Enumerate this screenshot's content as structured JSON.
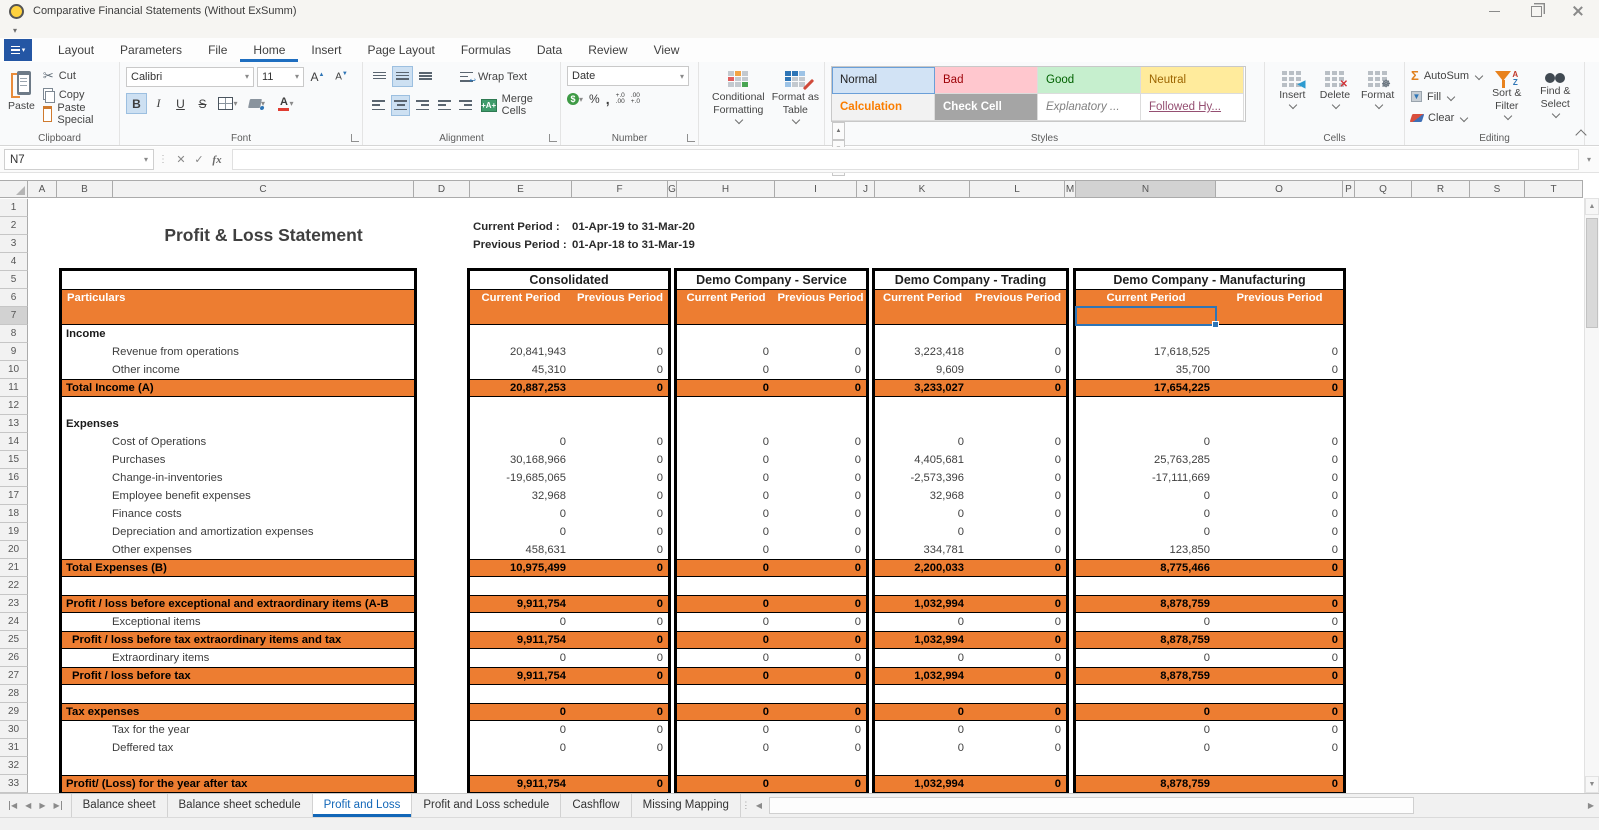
{
  "window": {
    "title": "Comparative Financial Statements (Without ExSumm)"
  },
  "icons": {
    "dropdown": "▾",
    "up": "▲",
    "down": "▼",
    "left": "◀",
    "right": "▶",
    "scissors": "✂",
    "sigma": "Σ",
    "percent": "%",
    "comma": ",",
    "currency": "$",
    "bold": "B",
    "italic": "I",
    "underline": "U",
    "strike": "S",
    "letter_a": "A",
    "grow_caret": "▲",
    "shrink_caret": "▼",
    "fx": "fx",
    "cancel": "✕",
    "check": "✓",
    "az_a": "A",
    "az_z": "Z",
    "inc0": "+.0",
    "inc00": ".00",
    "dec0": ".00",
    "dec00": "+.0",
    "wrap_arrow": "↩",
    "merge_plus": "+A+",
    "ellipsis_v": "⋮"
  },
  "menu": {
    "tabs": [
      "Layout",
      "Parameters",
      "File",
      "Home",
      "Insert",
      "Page Layout",
      "Formulas",
      "Data",
      "Review",
      "View"
    ],
    "active": "Home"
  },
  "ribbon": {
    "clipboard": {
      "label": "Clipboard",
      "paste": "Paste",
      "cut": "Cut",
      "copy": "Copy",
      "paste_special": "Paste Special"
    },
    "font": {
      "label": "Font",
      "family": "Calibri",
      "size": "11"
    },
    "alignment": {
      "label": "Alignment",
      "wrap_text": "Wrap Text",
      "merge_cells": "Merge Cells"
    },
    "number": {
      "label": "Number",
      "format": "Date"
    },
    "styles": {
      "label": "Styles",
      "conditional_formatting": "Conditional Formatting",
      "format_as_table": "Format as Table",
      "items": [
        {
          "label": "Normal",
          "bg": "#d2e3f5",
          "color": "#1f1f1f",
          "selected": true
        },
        {
          "label": "Bad",
          "bg": "#ffc7ce",
          "color": "#9c0006"
        },
        {
          "label": "Good",
          "bg": "#c6efce",
          "color": "#006100"
        },
        {
          "label": "Neutral",
          "bg": "#ffeb9c",
          "color": "#9c6500"
        },
        {
          "label": "Calculation",
          "bg": "#f2f2f2",
          "color": "#fa7d00",
          "bold": true
        },
        {
          "label": "Check Cell",
          "bg": "#a5a5a5",
          "color": "#ffffff",
          "bold": true
        },
        {
          "label": "Explanatory ...",
          "bg": "#ffffff",
          "color": "#7f7f7f",
          "italic": true
        },
        {
          "label": "Followed Hy...",
          "bg": "#ffffff",
          "color": "#954f72",
          "underline": true
        }
      ]
    },
    "cells": {
      "label": "Cells",
      "buttons": [
        "Insert",
        "Delete",
        "Format"
      ]
    },
    "editing": {
      "label": "Editing",
      "autosum": "AutoSum",
      "fill": "Fill",
      "clear": "Clear",
      "sort_filter": "Sort & Filter",
      "find_select": "Find & Select"
    }
  },
  "formula_bar": {
    "name_box": "N7",
    "formula": ""
  },
  "grid": {
    "columns": [
      "A",
      "B",
      "C",
      "D",
      "E",
      "F",
      "G",
      "H",
      "I",
      "J",
      "K",
      "L",
      "M",
      "N",
      "O",
      "P",
      "Q",
      "R",
      "S",
      "T"
    ],
    "selected_column": "N",
    "selected_row": 7,
    "selected_cell": "N7",
    "row_count": 33,
    "sheet_title": "Profit & Loss Statement",
    "periods": {
      "current_label": "Current Period :",
      "current_value": "01-Apr-19 to 31-Mar-20",
      "previous_label": "Previous Period :",
      "previous_value": "01-Apr-18 to 31-Mar-19"
    }
  },
  "statement": {
    "particulars_header": "Particulars",
    "column_headers": {
      "current": "Current Period",
      "previous": "Previous Period"
    },
    "accent_color": "#ED7D31",
    "rows": [
      {
        "r": 8,
        "label": "Income",
        "s": "b"
      },
      {
        "r": 9,
        "label": "Revenue from operations",
        "s": "i"
      },
      {
        "r": 10,
        "label": "Other income",
        "s": "i"
      },
      {
        "r": 11,
        "label": "Total Income (A)",
        "s": "t"
      },
      {
        "r": 13,
        "label": "Expenses",
        "s": "b"
      },
      {
        "r": 14,
        "label": "Cost of Operations",
        "s": "i"
      },
      {
        "r": 15,
        "label": "Purchases",
        "s": "i"
      },
      {
        "r": 16,
        "label": "Change-in-inventories",
        "s": "i"
      },
      {
        "r": 17,
        "label": "Employee benefit expenses",
        "s": "i"
      },
      {
        "r": 18,
        "label": "Finance costs",
        "s": "i"
      },
      {
        "r": 19,
        "label": "Depreciation and amortization expenses",
        "s": "i"
      },
      {
        "r": 20,
        "label": "Other expenses",
        "s": "i"
      },
      {
        "r": 21,
        "label": "Total Expenses (B)",
        "s": "t"
      },
      {
        "r": 23,
        "label": "Profit / loss before exceptional  and extraordinary items (A-B",
        "s": "t"
      },
      {
        "r": 24,
        "label": "Exceptional items",
        "s": "i"
      },
      {
        "r": 25,
        "label": "Profit / loss before tax extraordinary items and tax",
        "s": "ti"
      },
      {
        "r": 26,
        "label": "Extraordinary items",
        "s": "i"
      },
      {
        "r": 27,
        "label": "Profit / loss before tax",
        "s": "ti"
      },
      {
        "r": 29,
        "label": "Tax expenses",
        "s": "t"
      },
      {
        "r": 30,
        "label": "Tax for the year",
        "s": "i"
      },
      {
        "r": 31,
        "label": "Deffered tax",
        "s": "i"
      },
      {
        "r": 33,
        "label": "Profit/ (Loss) for the year after tax",
        "s": "t"
      }
    ],
    "panels": [
      {
        "name": "Consolidated",
        "values": {
          "9": [
            "20,841,943",
            "0"
          ],
          "10": [
            "45,310",
            "0"
          ],
          "11": [
            "20,887,253",
            "0"
          ],
          "14": [
            "0",
            "0"
          ],
          "15": [
            "30,168,966",
            "0"
          ],
          "16": [
            "-19,685,065",
            "0"
          ],
          "17": [
            "32,968",
            "0"
          ],
          "18": [
            "0",
            "0"
          ],
          "19": [
            "0",
            "0"
          ],
          "20": [
            "458,631",
            "0"
          ],
          "21": [
            "10,975,499",
            "0"
          ],
          "23": [
            "9,911,754",
            "0"
          ],
          "24": [
            "0",
            "0"
          ],
          "25": [
            "9,911,754",
            "0"
          ],
          "26": [
            "0",
            "0"
          ],
          "27": [
            "9,911,754",
            "0"
          ],
          "29": [
            "0",
            "0"
          ],
          "30": [
            "0",
            "0"
          ],
          "31": [
            "0",
            "0"
          ],
          "33": [
            "9,911,754",
            "0"
          ]
        }
      },
      {
        "name": "Demo Company - Service",
        "values": {
          "9": [
            "0",
            "0"
          ],
          "10": [
            "0",
            "0"
          ],
          "11": [
            "0",
            "0"
          ],
          "14": [
            "0",
            "0"
          ],
          "15": [
            "0",
            "0"
          ],
          "16": [
            "0",
            "0"
          ],
          "17": [
            "0",
            "0"
          ],
          "18": [
            "0",
            "0"
          ],
          "19": [
            "0",
            "0"
          ],
          "20": [
            "0",
            "0"
          ],
          "21": [
            "0",
            "0"
          ],
          "23": [
            "0",
            "0"
          ],
          "24": [
            "0",
            "0"
          ],
          "25": [
            "0",
            "0"
          ],
          "26": [
            "0",
            "0"
          ],
          "27": [
            "0",
            "0"
          ],
          "29": [
            "0",
            "0"
          ],
          "30": [
            "0",
            "0"
          ],
          "31": [
            "0",
            "0"
          ],
          "33": [
            "0",
            "0"
          ]
        }
      },
      {
        "name": "Demo Company - Trading",
        "values": {
          "9": [
            "3,223,418",
            "0"
          ],
          "10": [
            "9,609",
            "0"
          ],
          "11": [
            "3,233,027",
            "0"
          ],
          "14": [
            "0",
            "0"
          ],
          "15": [
            "4,405,681",
            "0"
          ],
          "16": [
            "-2,573,396",
            "0"
          ],
          "17": [
            "32,968",
            "0"
          ],
          "18": [
            "0",
            "0"
          ],
          "19": [
            "0",
            "0"
          ],
          "20": [
            "334,781",
            "0"
          ],
          "21": [
            "2,200,033",
            "0"
          ],
          "23": [
            "1,032,994",
            "0"
          ],
          "24": [
            "0",
            "0"
          ],
          "25": [
            "1,032,994",
            "0"
          ],
          "26": [
            "0",
            "0"
          ],
          "27": [
            "1,032,994",
            "0"
          ],
          "29": [
            "0",
            "0"
          ],
          "30": [
            "0",
            "0"
          ],
          "31": [
            "0",
            "0"
          ],
          "33": [
            "1,032,994",
            "0"
          ]
        }
      },
      {
        "name": "Demo Company - Manufacturing",
        "values": {
          "9": [
            "17,618,525",
            "0"
          ],
          "10": [
            "35,700",
            "0"
          ],
          "11": [
            "17,654,225",
            "0"
          ],
          "14": [
            "0",
            "0"
          ],
          "15": [
            "25,763,285",
            "0"
          ],
          "16": [
            "-17,111,669",
            "0"
          ],
          "17": [
            "0",
            "0"
          ],
          "18": [
            "0",
            "0"
          ],
          "19": [
            "0",
            "0"
          ],
          "20": [
            "123,850",
            "0"
          ],
          "21": [
            "8,775,466",
            "0"
          ],
          "23": [
            "8,878,759",
            "0"
          ],
          "24": [
            "0",
            "0"
          ],
          "25": [
            "8,878,759",
            "0"
          ],
          "26": [
            "0",
            "0"
          ],
          "27": [
            "8,878,759",
            "0"
          ],
          "29": [
            "0",
            "0"
          ],
          "30": [
            "0",
            "0"
          ],
          "31": [
            "0",
            "0"
          ],
          "33": [
            "8,878,759",
            "0"
          ]
        }
      }
    ]
  },
  "sheet_bar": {
    "tabs": [
      "Balance sheet",
      "Balance sheet schedule",
      "Profit and Loss",
      "Profit and Loss schedule",
      "Cashflow",
      "Missing Mapping"
    ],
    "active": "Profit and Loss"
  }
}
